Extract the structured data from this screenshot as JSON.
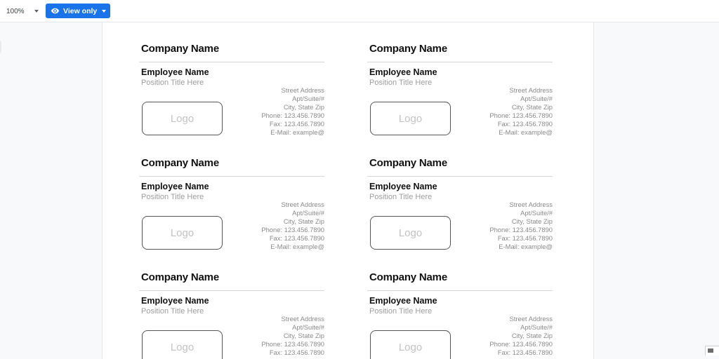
{
  "toolbar": {
    "zoom": "100%",
    "view_only_label": "View only",
    "icons": [
      "chevron-down-icon",
      "eye-icon",
      "chevron-down-icon"
    ],
    "accent_color": "#1a73e8"
  },
  "cards": [
    {
      "company": "Company Name",
      "employee": "Employee Name",
      "position": "Position Title Here",
      "address": [
        "Street Address",
        "Apt/Suite/#",
        "City, State Zip",
        "Phone: 123.456.7890",
        "Fax: 123.456.7890",
        "E-Mail: example@"
      ],
      "logo": "Logo"
    },
    {
      "company": "Company Name",
      "employee": "Employee Name",
      "position": "Position Title Here",
      "address": [
        "Street Address",
        "Apt/Suite/#",
        "City, State Zip",
        "Phone: 123.456.7890",
        "Fax: 123.456.7890",
        "E-Mail: example@"
      ],
      "logo": "Logo"
    },
    {
      "company": "Company Name",
      "employee": "Employee Name",
      "position": "Position Title Here",
      "address": [
        "Street Address",
        "Apt/Suite/#",
        "City, State Zip",
        "Phone: 123.456.7890",
        "Fax: 123.456.7890",
        "E-Mail: example@"
      ],
      "logo": "Logo"
    },
    {
      "company": "Company Name",
      "employee": "Employee Name",
      "position": "Position Title Here",
      "address": [
        "Street Address",
        "Apt/Suite/#",
        "City, State Zip",
        "Phone: 123.456.7890",
        "Fax: 123.456.7890",
        "E-Mail: example@"
      ],
      "logo": "Logo"
    },
    {
      "company": "Company Name",
      "employee": "Employee Name",
      "position": "Position Title Here",
      "address": [
        "Street Address",
        "Apt/Suite/#",
        "City, State Zip",
        "Phone: 123.456.7890",
        "Fax: 123.456.7890"
      ],
      "logo": "Logo"
    },
    {
      "company": "Company Name",
      "employee": "Employee Name",
      "position": "Position Title Here",
      "address": [
        "Street Address",
        "Apt/Suite/#",
        "City, State Zip",
        "Phone: 123.456.7890",
        "Fax: 123.456.7890"
      ],
      "logo": "Logo"
    }
  ]
}
